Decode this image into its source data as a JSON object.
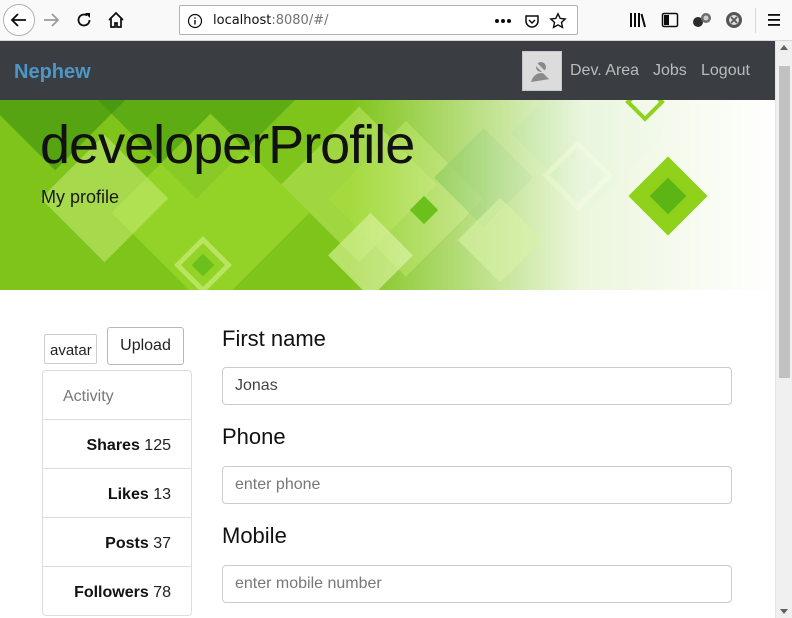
{
  "browser": {
    "url_host": "localhost",
    "url_rest": ":8080/#/",
    "icons": [
      "back-icon",
      "forward-icon",
      "reload-icon",
      "home-icon",
      "info-icon",
      "more-icon",
      "pocket-icon",
      "star-icon",
      "library-icon",
      "sidebar-icon",
      "extensions-icon",
      "addon-icon",
      "menu-icon"
    ]
  },
  "navbar": {
    "brand": "Nephew",
    "links": [
      "Dev. Area",
      "Jobs",
      "Logout"
    ],
    "brand_color": "#4e96c8",
    "bg_color": "#3a3e42"
  },
  "hero": {
    "title": "developerProfile",
    "subtitle": "My profile",
    "accent": "#7cc21a"
  },
  "profile": {
    "avatar_label": "avatar",
    "upload_label": "Upload"
  },
  "activity": {
    "header": "Activity",
    "rows": [
      {
        "label": "Shares",
        "value": "125"
      },
      {
        "label": "Likes",
        "value": "13"
      },
      {
        "label": "Posts",
        "value": "37"
      },
      {
        "label": "Followers",
        "value": "78"
      }
    ]
  },
  "form": {
    "first_name": {
      "label": "First name",
      "value": "Jonas",
      "placeholder": ""
    },
    "phone": {
      "label": "Phone",
      "value": "",
      "placeholder": "enter phone"
    },
    "mobile": {
      "label": "Mobile",
      "value": "",
      "placeholder": "enter mobile number"
    }
  }
}
